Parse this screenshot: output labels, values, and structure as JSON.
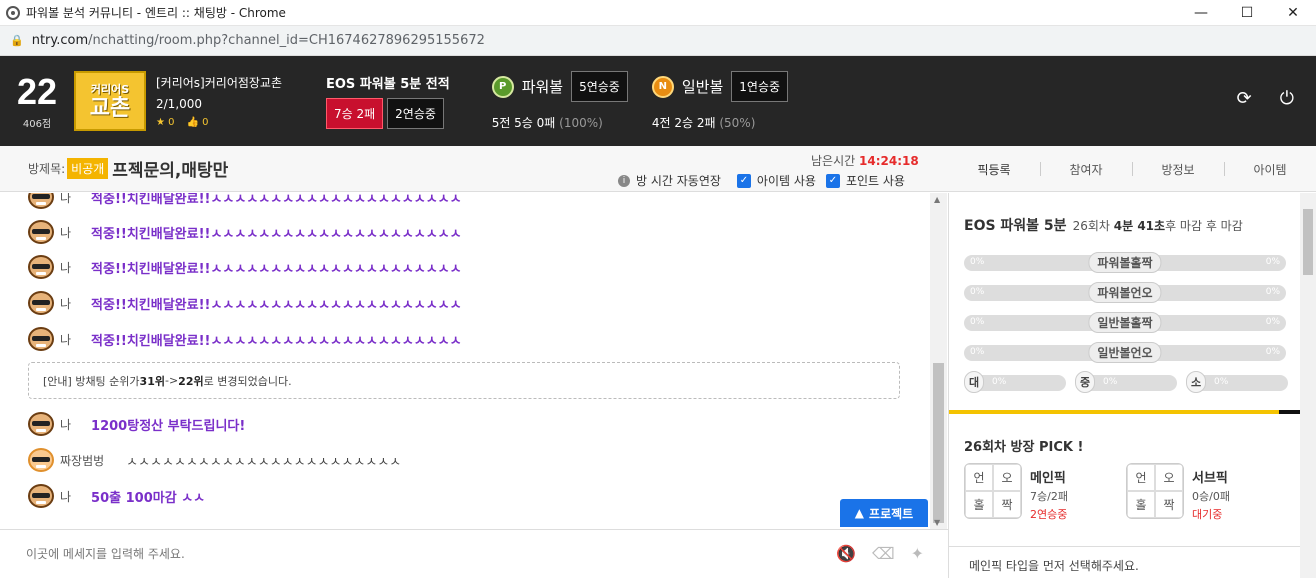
{
  "window": {
    "title": "파워볼 분석 커뮤니티 - 엔트리 :: 채팅방 - Chrome",
    "min": "—",
    "max": "☐",
    "close": "✕"
  },
  "address": {
    "host": "ntry.com",
    "path": "/nchatting/room.php?channel_id=CH1674627896295155672"
  },
  "header": {
    "rank": "22",
    "points": "406점",
    "logo_small": "커리어S",
    "logo_big": "교촌",
    "room_name": "[커리어s]커리어점장교촌",
    "room_count": "2/1,000",
    "stars": "0",
    "likes": "0",
    "eos_title": "EOS 파워볼 5분 전적",
    "eos_record": "7승 2패",
    "eos_streak": "2연승중",
    "powerball": {
      "coin": "P",
      "name": "파워볼",
      "streak": "5연승중",
      "summary": "5전 5승 0패",
      "rate": "(100%)"
    },
    "normalball": {
      "coin": "N",
      "name": "일반볼",
      "streak": "1연승중",
      "summary": "4전 2승 2패",
      "rate": "(50%)"
    }
  },
  "roombar": {
    "label": "방제목:",
    "privacy": "비공개",
    "title": "프젝문의,매탕만",
    "remain_label": "남은시간",
    "remain_time": "14:24:18",
    "auto_extend": "방 시간 자동연장",
    "item_use": "아이템 사용",
    "point_use": "포인트 사용"
  },
  "tabs": [
    "픽등록",
    "참여자",
    "방정보",
    "아이템"
  ],
  "chat": {
    "messages": [
      {
        "nick": "나",
        "text": "적중!!치킨배달완료!!ㅅㅅㅅㅅㅅㅅㅅㅅㅅㅅㅅㅅㅅㅅㅅㅅㅅㅅㅅㅅㅅ"
      },
      {
        "nick": "나",
        "text": "적중!!치킨배달완료!!ㅅㅅㅅㅅㅅㅅㅅㅅㅅㅅㅅㅅㅅㅅㅅㅅㅅㅅㅅㅅㅅ"
      },
      {
        "nick": "나",
        "text": "적중!!치킨배달완료!!ㅅㅅㅅㅅㅅㅅㅅㅅㅅㅅㅅㅅㅅㅅㅅㅅㅅㅅㅅㅅㅅ"
      },
      {
        "nick": "나",
        "text": "적중!!치킨배달완료!!ㅅㅅㅅㅅㅅㅅㅅㅅㅅㅅㅅㅅㅅㅅㅅㅅㅅㅅㅅㅅㅅ"
      },
      {
        "nick": "나",
        "text": "적중!!치킨배달완료!!ㅅㅅㅅㅅㅅㅅㅅㅅㅅㅅㅅㅅㅅㅅㅅㅅㅅㅅㅅㅅㅅ"
      }
    ],
    "notice": {
      "prefix": "[안내] 방채팅 순위가 ",
      "from": "31위",
      "arrow": " -> ",
      "to": "22위",
      "suffix": " 로 변경되었습니다."
    },
    "msg6": {
      "nick": "나",
      "text": "1200탕정산 부탁드립니다!"
    },
    "msg7": {
      "nick": "짜장범벙",
      "text": "ㅅㅅㅅㅅㅅㅅㅅㅅㅅㅅㅅㅅㅅㅅㅅㅅㅅㅅㅅㅅㅅㅅㅅ"
    },
    "msg8": {
      "nick": "나",
      "text": "50출 100마감 ㅅㅅ"
    },
    "protect": "프로젝트",
    "input_placeholder": "이곳에 메세지를 입력해 주세요."
  },
  "panel": {
    "game": "EOS 파워볼 5분",
    "round": "26회차",
    "time": "4분 41초",
    "suffix": "후 마감",
    "suffix2": "후 마감",
    "bars": [
      {
        "label": "파워볼홀짝",
        "left": "0%",
        "right": "0%"
      },
      {
        "label": "파워볼언오",
        "left": "0%",
        "right": "0%"
      },
      {
        "label": "일반볼홀짝",
        "left": "0%",
        "right": "0%"
      },
      {
        "label": "일반볼언오",
        "left": "0%",
        "right": "0%"
      }
    ],
    "size_bars": [
      {
        "icon": "대",
        "value": "0%"
      },
      {
        "icon": "중",
        "value": "0%"
      },
      {
        "icon": "소",
        "value": "0%"
      }
    ],
    "pick_title": "26회차 방장 PICK !",
    "main": {
      "title": "메인픽",
      "record": "7승/2패",
      "status": "2연승중",
      "cells": [
        "언",
        "오",
        "홀",
        "짝"
      ]
    },
    "sub": {
      "title": "서브픽",
      "record": "0승/0패",
      "status": "대기중",
      "cells": [
        "언",
        "오",
        "홀",
        "짝"
      ]
    },
    "footer": "메인픽 타입을 먼저 선택해주세요."
  }
}
